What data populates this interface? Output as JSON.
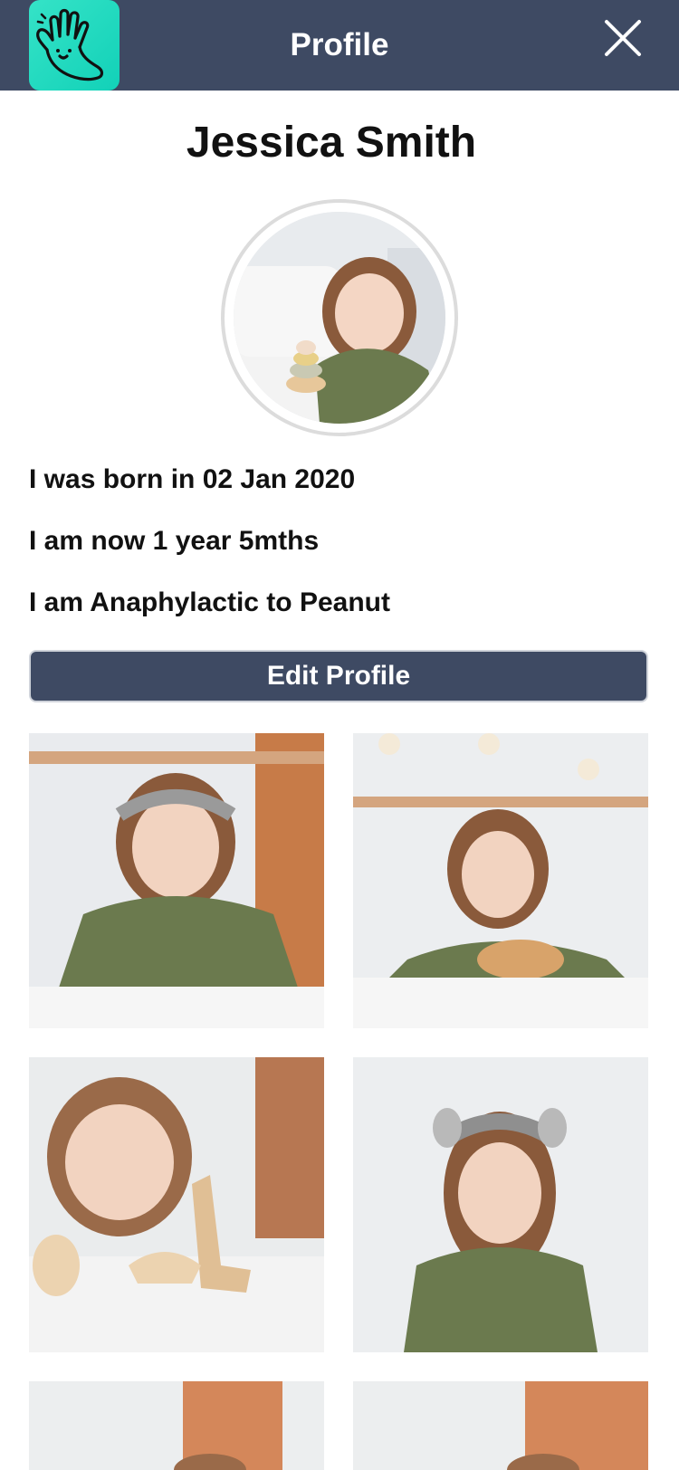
{
  "header": {
    "title": "Profile",
    "logo_icon": "waving-hand-icon",
    "close_icon": "close-icon",
    "background": "#3e4a63",
    "logo_color": "#1fd9bf"
  },
  "profile": {
    "name": "Jessica Smith",
    "born_text": "I was born in 02 Jan 2020",
    "age_text": "I am now 1 year 5mths",
    "allergy_text": "I am Anaphylactic to Peanut"
  },
  "actions": {
    "edit_label": "Edit Profile"
  },
  "gallery": {
    "photo_count_visible": 6
  }
}
